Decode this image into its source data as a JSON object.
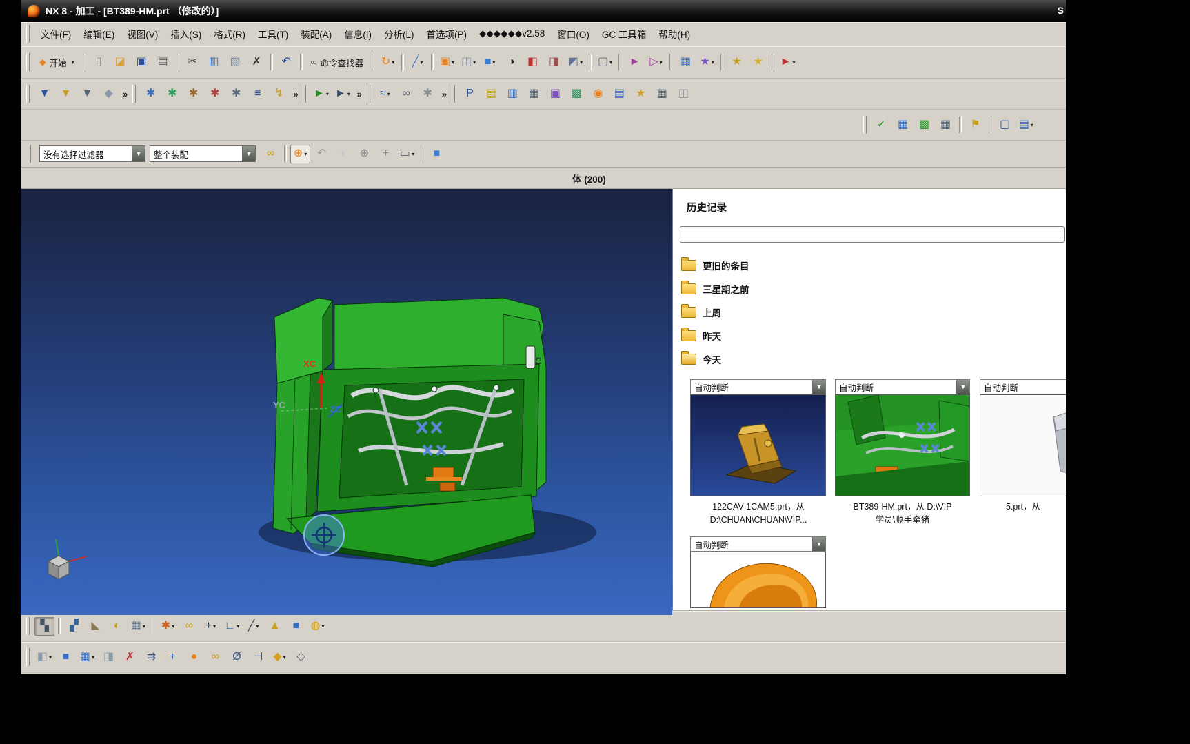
{
  "window": {
    "title": "NX 8 - 加工 - [BT389-HM.prt （修改的）]",
    "edge_letter": "S"
  },
  "menu": {
    "items": [
      "文件(F)",
      "编辑(E)",
      "视图(V)",
      "插入(S)",
      "格式(R)",
      "工具(T)",
      "装配(A)",
      "信息(I)",
      "分析(L)",
      "首选项(P)",
      "◆◆◆◆◆◆v2.58",
      "窗口(O)",
      "GC 工具箱",
      "帮助(H)"
    ]
  },
  "toolbars": {
    "row1": [
      {
        "t": "grip"
      },
      {
        "n": "start-button",
        "btn": true,
        "label": "开始",
        "g": "◆",
        "c": "#e8821e",
        "dd": true
      },
      {
        "t": "sep"
      },
      {
        "n": "new-file-icon",
        "g": "▯",
        "c": "#8a8a8a"
      },
      {
        "n": "open-icon",
        "g": "◪",
        "c": "#d9a23c"
      },
      {
        "n": "save-icon",
        "g": "▣",
        "c": "#2a52a0"
      },
      {
        "n": "print-icon",
        "g": "▤",
        "c": "#5a5a5a"
      },
      {
        "t": "sep"
      },
      {
        "n": "cut-icon",
        "g": "✂",
        "c": "#444444"
      },
      {
        "n": "copy-icon",
        "g": "▥",
        "c": "#3a6fbf"
      },
      {
        "n": "paste-icon",
        "g": "▧",
        "c": "#7a8aa0"
      },
      {
        "n": "delete-icon",
        "g": "✗",
        "c": "#333333"
      },
      {
        "t": "sep"
      },
      {
        "n": "undo-icon",
        "g": "↶",
        "c": "#2a52a0"
      },
      {
        "t": "sep"
      },
      {
        "n": "command-finder-button",
        "btn": true,
        "label": "命令查找器",
        "g": "∞",
        "c": "#333333"
      },
      {
        "t": "sep"
      },
      {
        "n": "refresh-icon",
        "g": "↻",
        "c": "#e8821e",
        "dd": true
      },
      {
        "t": "sep"
      },
      {
        "n": "datum-icon",
        "g": "╱",
        "c": "#3a6fbf",
        "dd": true
      },
      {
        "t": "sep"
      },
      {
        "n": "orient-view-icon",
        "g": "▣",
        "c": "#e8821e",
        "dd": true
      },
      {
        "n": "clip-section-icon",
        "g": "◫",
        "c": "#8a98a8",
        "dd": true
      },
      {
        "n": "shaded-view-icon",
        "g": "■",
        "c": "#3a7fd0",
        "dd": true
      },
      {
        "n": "render-style-icon",
        "g": "◑",
        "c": "#222222"
      },
      {
        "n": "face-analysis-icon",
        "g": "◧",
        "c": "#c03030"
      },
      {
        "n": "assembly-cube-icon",
        "g": "◨",
        "c": "#a05050"
      },
      {
        "n": "wireframe-cube-icon",
        "g": "◩",
        "c": "#607090",
        "dd": true
      },
      {
        "t": "sep"
      },
      {
        "n": "window-icon",
        "g": "▢",
        "c": "#606878",
        "dd": true
      },
      {
        "t": "sep"
      },
      {
        "n": "flip-view-icon",
        "g": "►",
        "c": "#a040a0"
      },
      {
        "n": "mirror-view-icon",
        "g": "▷",
        "c": "#a040a0",
        "dd": true
      },
      {
        "t": "sep"
      },
      {
        "n": "part-navigator-icon",
        "g": "▦",
        "c": "#3a6fbf"
      },
      {
        "n": "relations-icon",
        "g": "★",
        "c": "#7a4fbf",
        "dd": true
      },
      {
        "t": "sep"
      },
      {
        "n": "key1-icon",
        "g": "★",
        "c": "#c8a020"
      },
      {
        "n": "key2-icon",
        "g": "★",
        "c": "#d8b030"
      },
      {
        "t": "sep"
      },
      {
        "n": "run-macro-icon",
        "g": "►",
        "c": "#c03030",
        "dd": true
      }
    ],
    "row2": [
      {
        "t": "grip"
      },
      {
        "n": "mill-tool-icon",
        "g": "▼",
        "c": "#2a52a0"
      },
      {
        "n": "drill-tool-icon",
        "g": "▼",
        "c": "#c8a020"
      },
      {
        "n": "probe-tool-icon",
        "g": "▼",
        "c": "#556677"
      },
      {
        "n": "holder-icon",
        "g": "◆",
        "c": "#8899aa"
      },
      {
        "t": "chev"
      },
      {
        "t": "grip"
      },
      {
        "n": "create-program-icon",
        "g": "✱",
        "c": "#3a6fbf"
      },
      {
        "n": "create-tool-icon",
        "g": "✱",
        "c": "#2a9a5a"
      },
      {
        "n": "create-geometry-icon",
        "g": "✱",
        "c": "#9a6a2a"
      },
      {
        "n": "create-method-icon",
        "g": "✱",
        "c": "#b04040"
      },
      {
        "n": "create-operation-icon",
        "g": "✱",
        "c": "#556677"
      },
      {
        "n": "edit-operation-icon",
        "g": "≡",
        "c": "#2a52a0"
      },
      {
        "n": "generate-toolpath-icon",
        "g": "↯",
        "c": "#caa020"
      },
      {
        "t": "chev"
      },
      {
        "t": "grip"
      },
      {
        "n": "replay-toolpath-icon",
        "g": "►",
        "c": "#2a8a2a",
        "dd": true
      },
      {
        "n": "verify-toolpath-icon",
        "g": "►",
        "c": "#30506e",
        "dd": true
      },
      {
        "t": "chev"
      },
      {
        "t": "grip"
      },
      {
        "n": "toolpath-graph-icon",
        "g": "≈",
        "c": "#2a52a0",
        "dd": true
      },
      {
        "n": "gouge-check-icon",
        "g": "∞",
        "c": "#556677"
      },
      {
        "n": "machine-sim-icon",
        "g": "✱",
        "c": "#889090"
      },
      {
        "t": "chev"
      },
      {
        "t": "grip"
      },
      {
        "n": "postprocess-icon",
        "g": "P",
        "c": "#2a52a0"
      },
      {
        "n": "shop-doc-icon",
        "g": "▤",
        "c": "#caa020"
      },
      {
        "n": "toolpath-report-icon",
        "g": "▥",
        "c": "#3a6fbf"
      },
      {
        "n": "cse-editor-icon",
        "g": "▦",
        "c": "#556677"
      },
      {
        "n": "workpiece-icon",
        "g": "▣",
        "c": "#7a4fbf"
      },
      {
        "n": "machine-nav-icon",
        "g": "▩",
        "c": "#2a8a5a"
      },
      {
        "n": "tiger-icon",
        "g": "◉",
        "c": "#e8821e"
      },
      {
        "n": "print-doc-icon",
        "g": "▤",
        "c": "#3a6fbf"
      },
      {
        "n": "tool-wrench-icon",
        "g": "★",
        "c": "#caa020"
      },
      {
        "n": "grid-icon",
        "g": "▦",
        "c": "#556677"
      },
      {
        "n": "layout-icon",
        "g": "◫",
        "c": "#8899aa"
      }
    ],
    "row3": [
      {
        "t": "grip"
      },
      {
        "n": "approve-icon",
        "g": "✓",
        "c": "#2a9a2a"
      },
      {
        "n": "plan-icon",
        "g": "▦",
        "c": "#3a6fbf"
      },
      {
        "n": "green-table-icon",
        "g": "▩",
        "c": "#2a9a2a"
      },
      {
        "n": "sheet-icon",
        "g": "▦",
        "c": "#556677"
      },
      {
        "t": "sep"
      },
      {
        "n": "flag-icon",
        "g": "⚑",
        "c": "#c8a020"
      },
      {
        "t": "sep"
      },
      {
        "n": "monitor-icon",
        "g": "▢",
        "c": "#2a52a0"
      },
      {
        "n": "report-icon",
        "g": "▤",
        "c": "#3a6fbf",
        "dd": true
      }
    ],
    "selection": [
      {
        "n": "snapshot-icon",
        "g": "∞",
        "c": "#caa020"
      },
      {
        "t": "sep"
      },
      {
        "n": "point-dialog-icon",
        "g": "⊕",
        "c": "#e8821e",
        "dd": true,
        "boxed": true
      },
      {
        "n": "undo-selection-icon",
        "g": "↶",
        "c": "#9a9a9a"
      },
      {
        "n": "face-rule-icon",
        "g": "◗",
        "c": "#c0c6cc"
      },
      {
        "n": "rotate-point-icon",
        "g": "⊕",
        "c": "#8a8a8a"
      },
      {
        "n": "general-select-icon",
        "g": "+",
        "c": "#8a8a8a"
      },
      {
        "n": "marquee-select-icon",
        "g": "▭",
        "c": "#556677",
        "dd": true
      },
      {
        "t": "sep"
      },
      {
        "n": "shaded-context-icon",
        "g": "■",
        "c": "#3a7fd0"
      }
    ],
    "bottom1": [
      {
        "t": "grip"
      },
      {
        "n": "window-cascade-icon",
        "g": "▚",
        "c": "#445566",
        "pressed": true
      },
      {
        "t": "sep"
      },
      {
        "n": "operation-nav-icon",
        "g": "▞",
        "c": "#336699"
      },
      {
        "n": "machine-view-icon",
        "g": "◣",
        "c": "#887755"
      },
      {
        "n": "show-hide-icon",
        "g": "◐",
        "c": "#caa020"
      },
      {
        "n": "wcs-display-icon",
        "g": "▦",
        "c": "#667788",
        "dd": true
      },
      {
        "t": "sep"
      },
      {
        "n": "object-display-icon",
        "g": "✱",
        "c": "#d06020",
        "dd": true
      },
      {
        "n": "link-icon",
        "g": "∞",
        "c": "#caa020"
      },
      {
        "n": "plus-icon",
        "g": "+",
        "c": "#223344",
        "dd": true
      },
      {
        "n": "snap-point-icon",
        "g": "∟",
        "c": "#3a6fbf",
        "dd": true
      },
      {
        "n": "sketch-icon",
        "g": "╱",
        "c": "#334455",
        "dd": true
      },
      {
        "n": "prism-icon",
        "g": "▲",
        "c": "#caa020"
      },
      {
        "n": "cube-icon",
        "g": "■",
        "c": "#3a6fbf"
      },
      {
        "n": "mesh-sphere-icon",
        "g": "◍",
        "c": "#caa020",
        "dd": true
      }
    ],
    "bottom2": [
      {
        "t": "grip"
      },
      {
        "n": "small-cube-icon",
        "g": "◧",
        "c": "#8899aa",
        "dd": true
      },
      {
        "n": "solid-cube-icon",
        "g": "■",
        "c": "#3a6fbf"
      },
      {
        "n": "add-component-icon",
        "g": "▦",
        "c": "#3a6fbf",
        "dd": true
      },
      {
        "n": "move-component-icon",
        "g": "◨",
        "c": "#8899aa"
      },
      {
        "n": "constraints-icon",
        "g": "✗",
        "c": "#c03030"
      },
      {
        "n": "sequence-icon",
        "g": "⇉",
        "c": "#335588"
      },
      {
        "n": "point-icon",
        "g": "+",
        "c": "#3a6fbf"
      },
      {
        "n": "ball-icon",
        "g": "●",
        "c": "#e8821e"
      },
      {
        "n": "chain-icon",
        "g": "∞",
        "c": "#caa020"
      },
      {
        "n": "measure-icon",
        "g": "Ø",
        "c": "#335588"
      },
      {
        "n": "offset-icon",
        "g": "⊣",
        "c": "#335588"
      },
      {
        "n": "gold-diamond-icon",
        "g": "◆",
        "c": "#d8a020",
        "dd": true
      },
      {
        "n": "last-cube-icon",
        "g": "◇",
        "c": "#556677"
      }
    ]
  },
  "selection_bar": {
    "filter_value": "没有选择过滤器",
    "scope_value": "整个装配"
  },
  "status_bar": {
    "text": "体 (200)"
  },
  "viewport": {
    "xc": "XC",
    "yc": "YC",
    "zc": "ZC",
    "part_label": "D1"
  },
  "history": {
    "title": "历史记录",
    "search_value": "",
    "folders": [
      {
        "label": "更旧的条目"
      },
      {
        "label": "三星期之前"
      },
      {
        "label": "上周"
      },
      {
        "label": "昨天"
      },
      {
        "label": "今天",
        "open": true
      }
    ],
    "thumbs": [
      {
        "dropdown": "自动判断",
        "caption": "122CAV-1CAM5.prt，从\nD:\\CHUAN\\CHUAN\\VIP..."
      },
      {
        "dropdown": "自动判断",
        "caption": "BT389-HM.prt，从 D:\\VIP\n学员\\顺手牵猪"
      },
      {
        "dropdown": "自动判断",
        "caption": "5.prt，从"
      },
      {
        "dropdown": "自动判断",
        "caption": ""
      }
    ]
  }
}
